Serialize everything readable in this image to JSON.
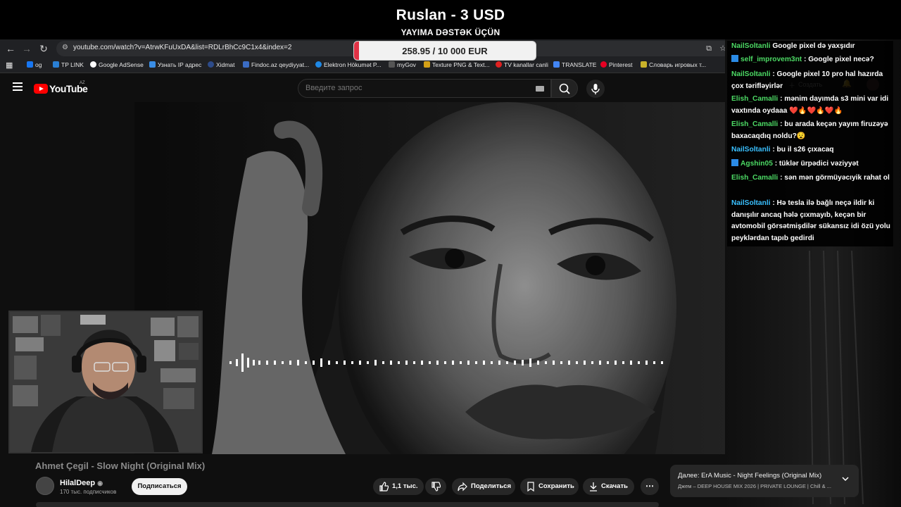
{
  "donation": {
    "title": "Ruslan - 3 USD",
    "subtitle": "YAYIMA DƏSTƏK ÜÇÜN",
    "goal_text": "258.95 / 10 000 EUR",
    "goal_fraction": 0.026
  },
  "browser": {
    "url": "youtube.com/watch?v=AtrwKFuUxDA&list=RDLrBhCc9C1x4&index=2",
    "bookmarks": [
      "og",
      "TP LINK",
      "Google AdSense",
      "Узнать IP адрес",
      "Xidmat",
      "Findoc.az qeydiyyat...",
      "Elektron Hökumət P...",
      "myGov",
      "Texture PNG & Text...",
      "TV kanallar canli",
      "TRANSLATE",
      "Pinterest",
      "Словарь игровых т..."
    ]
  },
  "youtube": {
    "logo": "YouTube",
    "country": "AZ",
    "search_placeholder": "Введите запрос"
  },
  "chat": {
    "messages": [
      {
        "user": "NailSoltanli",
        "text": " Google pixel də yaxşıdır",
        "color": "green"
      },
      {
        "user": "self_improvem3nt",
        "text": " : Google pixel necə?",
        "color": "green",
        "icon": true
      },
      {
        "user": "NailSoltanli",
        "text": " : Google pixel 10 pro hal hazırda çox tərifləyirlər",
        "color": "green"
      },
      {
        "user": "Elish_Camalli",
        "text": " : mənim dayımda s3 mini var idi vaxtında oydaaa ❤️🔥❤️🔥❤️🔥",
        "color": "green"
      },
      {
        "user": "Elish_Camalli",
        "text": " : bu arada keçən yayım firuzəyə baxacaqdıq noldu?😧",
        "color": "green"
      },
      {
        "user": "NailSoltanli",
        "text": " : bu il s26 çıxacaq",
        "color": "cyan"
      },
      {
        "user": "Agshin05",
        "text": " : tüklər ürpədici vəziyyət",
        "color": "green",
        "icon": true
      },
      {
        "user": "Elish_Camalli",
        "text": " : sən mən görmüyəcıyik rahat ol",
        "color": "green"
      },
      {
        "user": "NailSoltanli",
        "text": " : Hə tesla ilə bağlı neçə ildir ki danışılır ancaq hələ çıxmayıb, keçən bir avtomobil görsətmişdilər sükansız idi özü yolu peyklərdan tapıb gedirdi",
        "color": "cyan"
      }
    ]
  },
  "video": {
    "title": "Ahmet Çegil - Slow Night (Original Mix)",
    "channel": "HilalDeep",
    "subscribers": "170 тыс. подписчиков",
    "subscribe_label": "Подписаться",
    "likes": "1,1 тыс.",
    "share_label": "Поделиться",
    "save_label": "Сохранить",
    "download_label": "Скачать"
  },
  "next": {
    "title": "Далее: ErA Music - Night Feelings (Original Mix)",
    "subtitle": "Джем – DEEP HOUSE MIX 2026 | PRIVATE LOUNGE | Chill & ..."
  },
  "colors": {
    "accent": "#ff0000",
    "goal": "#e03246",
    "chat_name": "#4cd964",
    "chat_name_alt": "#3ac0ff"
  }
}
